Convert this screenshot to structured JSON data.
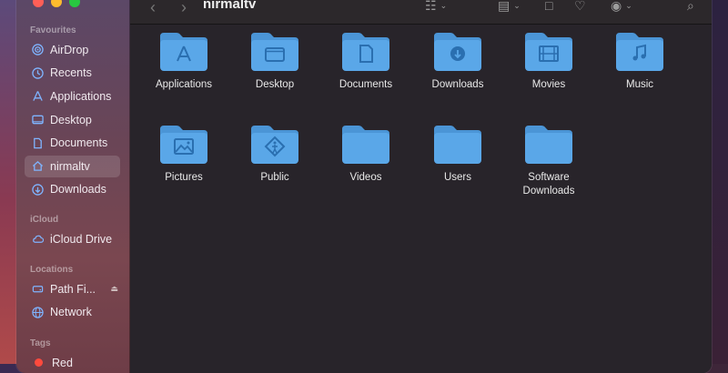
{
  "window": {
    "title": "nirmaltv"
  },
  "sidebar": {
    "favourites_heading": "Favourites",
    "favourites": [
      {
        "label": "AirDrop",
        "icon": "airdrop-icon"
      },
      {
        "label": "Recents",
        "icon": "clock-icon"
      },
      {
        "label": "Applications",
        "icon": "applications-icon"
      },
      {
        "label": "Desktop",
        "icon": "desktop-icon"
      },
      {
        "label": "Documents",
        "icon": "document-icon"
      },
      {
        "label": "nirmaltv",
        "icon": "home-icon",
        "selected": true
      },
      {
        "label": "Downloads",
        "icon": "download-icon"
      }
    ],
    "icloud_heading": "iCloud",
    "icloud": [
      {
        "label": "iCloud Drive",
        "icon": "cloud-icon"
      }
    ],
    "locations_heading": "Locations",
    "locations": [
      {
        "label": "Path Fi...",
        "icon": "drive-icon",
        "eject": true
      },
      {
        "label": "Network",
        "icon": "network-icon"
      }
    ],
    "tags_heading": "Tags",
    "tags": [
      {
        "label": "Red",
        "color": "#ff4a3d"
      }
    ]
  },
  "folders": [
    {
      "label": "Applications",
      "glyph": "applications"
    },
    {
      "label": "Desktop",
      "glyph": "desktop"
    },
    {
      "label": "Documents",
      "glyph": "document"
    },
    {
      "label": "Downloads",
      "glyph": "download"
    },
    {
      "label": "Movies",
      "glyph": "film"
    },
    {
      "label": "Music",
      "glyph": "music"
    },
    {
      "label": "Pictures",
      "glyph": "picture"
    },
    {
      "label": "Public",
      "glyph": "public"
    },
    {
      "label": "Videos",
      "glyph": "none"
    },
    {
      "label": "Users",
      "glyph": "none"
    },
    {
      "label": "Software Downloads",
      "glyph": "none"
    }
  ],
  "colors": {
    "folder": "#5aa7e8",
    "folder_tab": "#4b95d6",
    "accent": "#7fb4ff"
  }
}
